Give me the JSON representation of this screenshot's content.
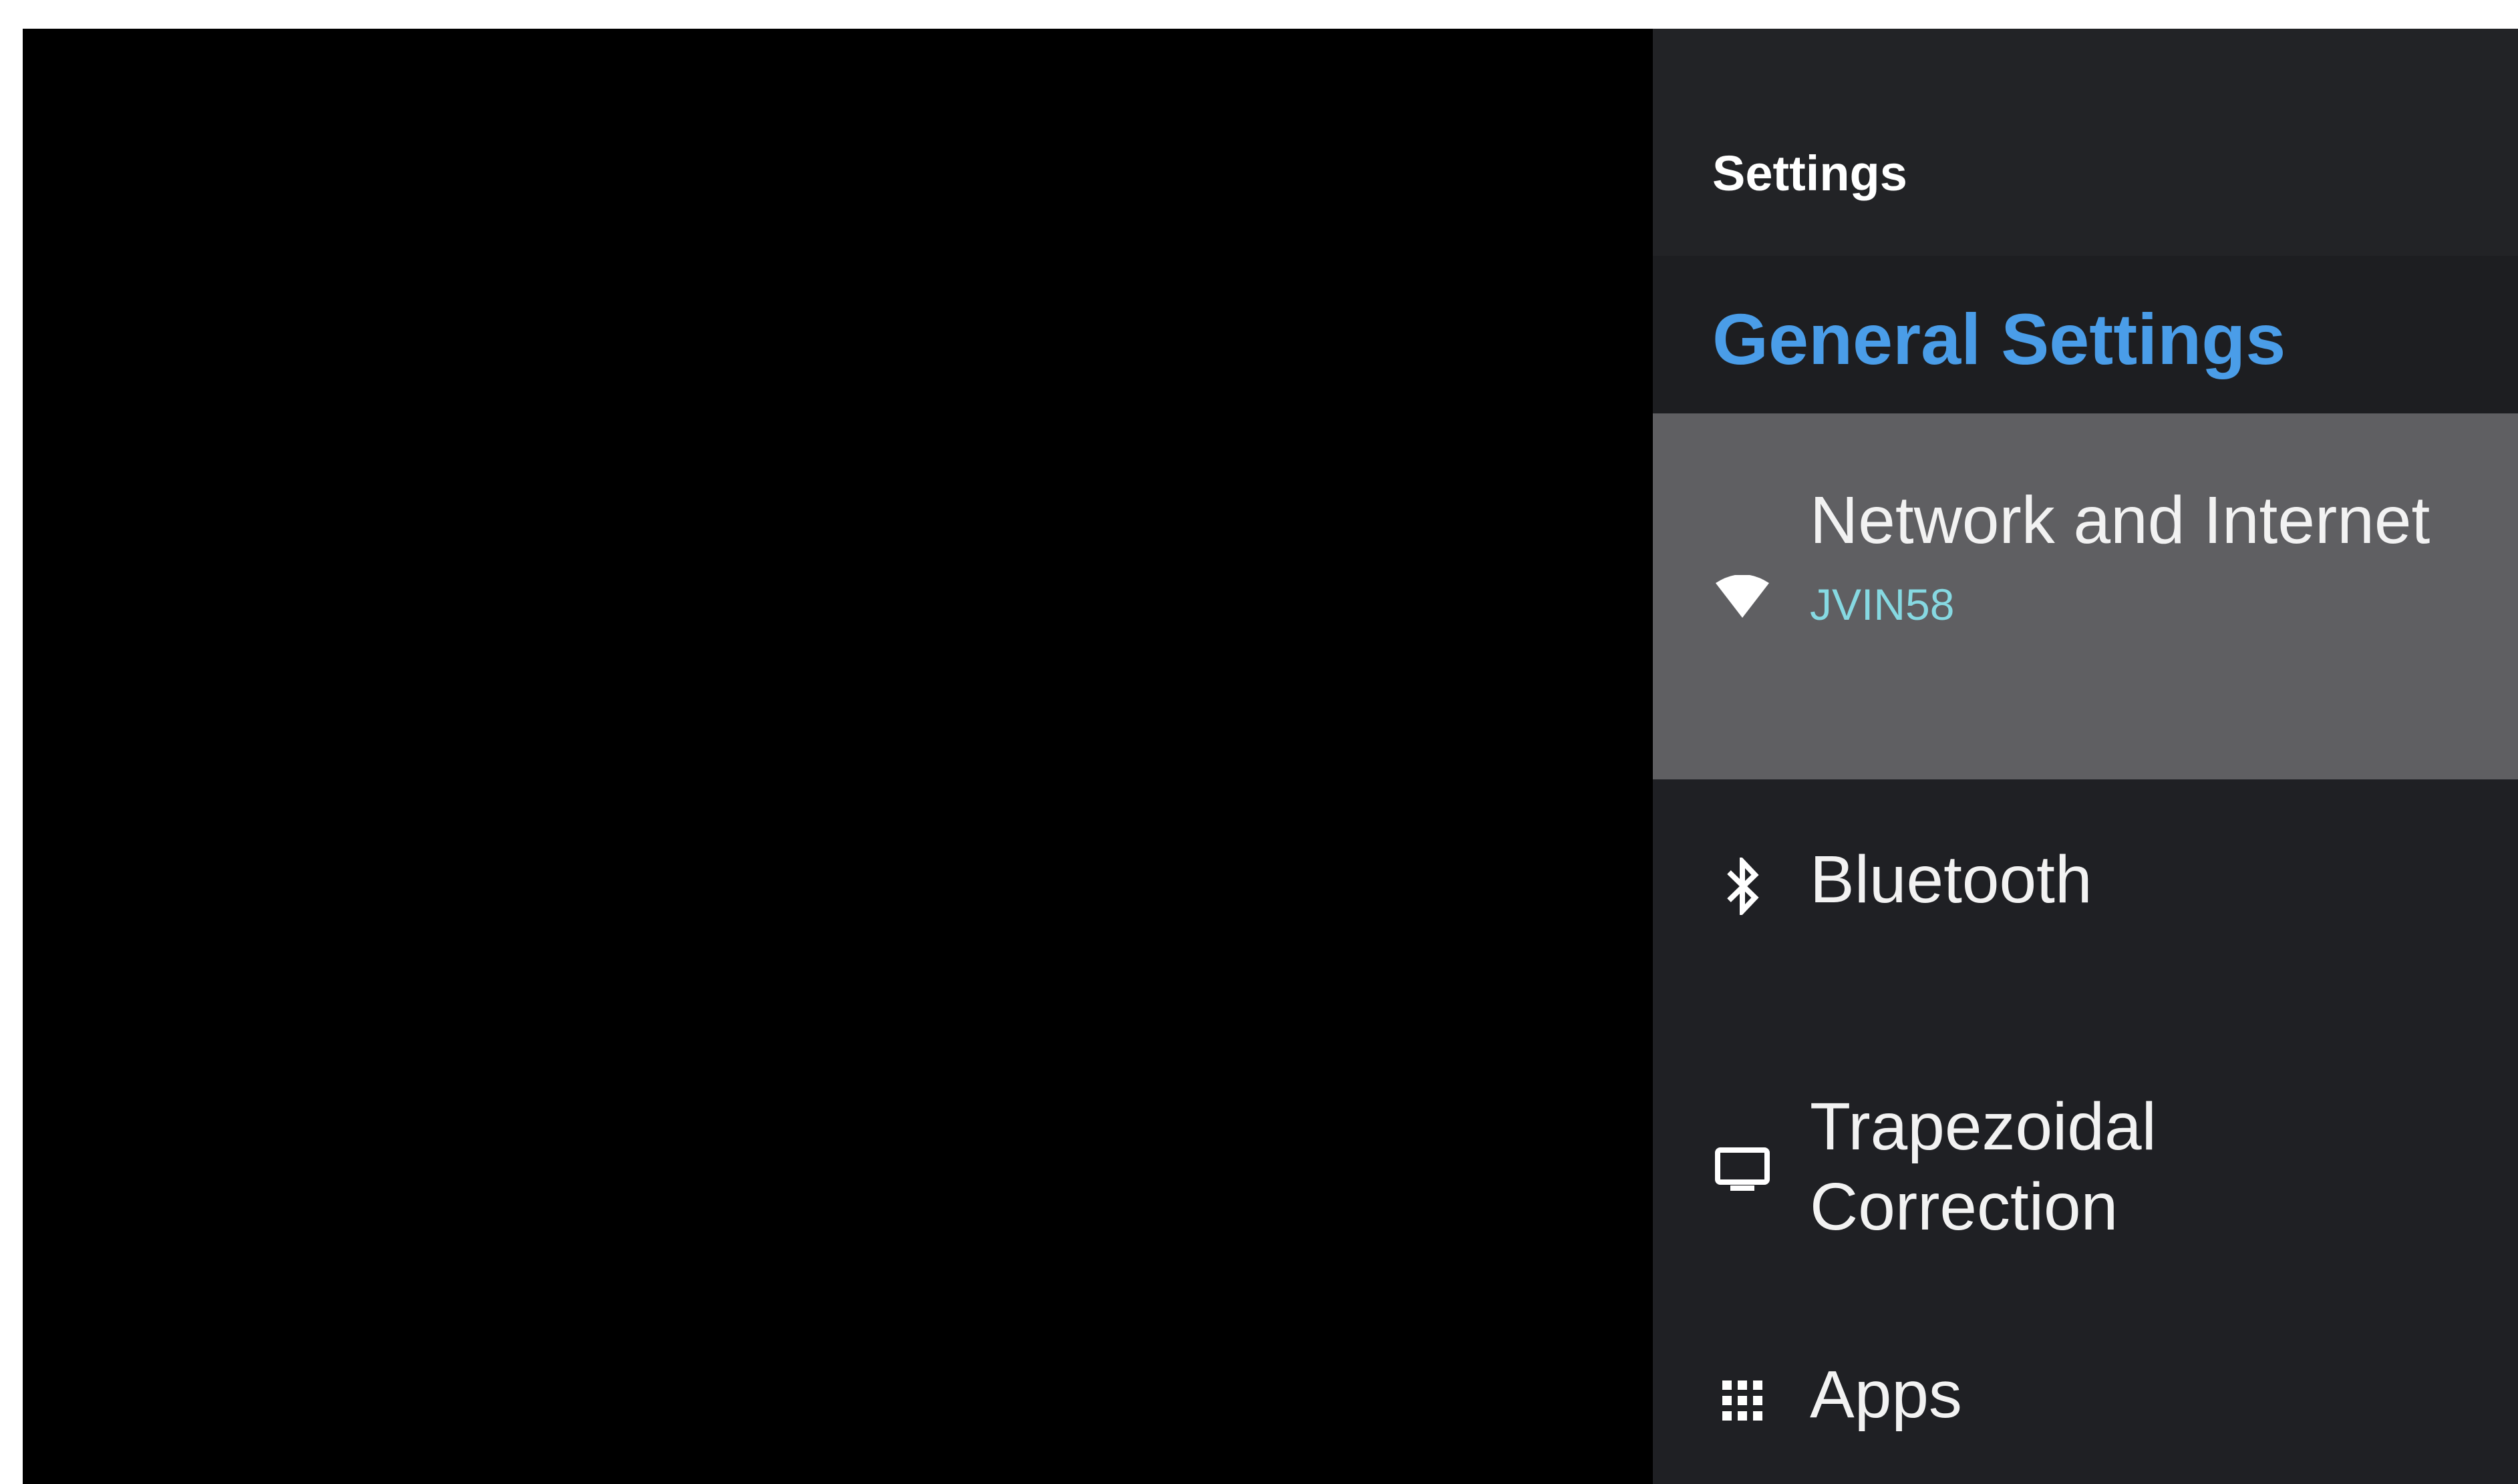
{
  "panel": {
    "title": "Settings",
    "section_title": "General Settings",
    "accent_color": "#4a9de8",
    "selected_background": "#5f5f62",
    "subtitle_color": "#86d9e2"
  },
  "items": [
    {
      "label": "Network and Internet",
      "subtitle": "JVIN58",
      "icon": "wifi-icon",
      "selected": true
    },
    {
      "label": "Bluetooth",
      "icon": "bluetooth-icon",
      "selected": false
    },
    {
      "label": "Trapezoidal Correction",
      "icon": "display-icon",
      "selected": false
    },
    {
      "label": "Apps",
      "icon": "apps-grid-icon",
      "selected": false
    }
  ]
}
